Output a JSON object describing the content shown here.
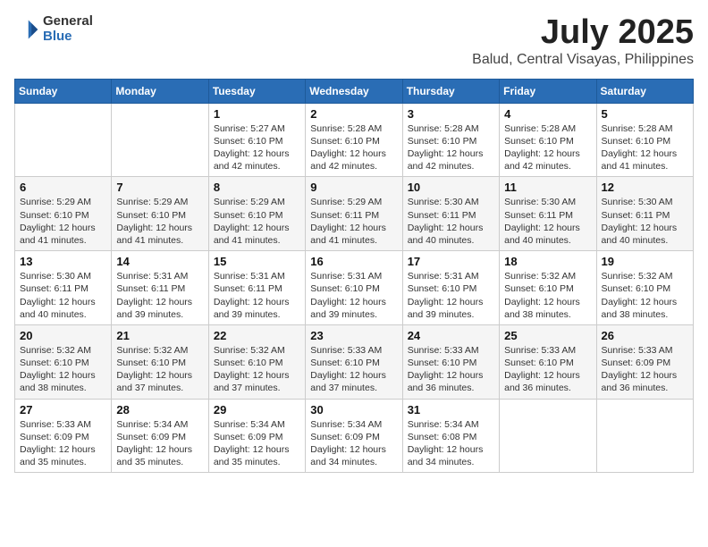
{
  "header": {
    "logo_line1": "General",
    "logo_line2": "Blue",
    "title": "July 2025",
    "subtitle": "Balud, Central Visayas, Philippines"
  },
  "weekdays": [
    "Sunday",
    "Monday",
    "Tuesday",
    "Wednesday",
    "Thursday",
    "Friday",
    "Saturday"
  ],
  "weeks": [
    [
      {
        "day": "",
        "info": ""
      },
      {
        "day": "",
        "info": ""
      },
      {
        "day": "1",
        "info": "Sunrise: 5:27 AM\nSunset: 6:10 PM\nDaylight: 12 hours and 42 minutes."
      },
      {
        "day": "2",
        "info": "Sunrise: 5:28 AM\nSunset: 6:10 PM\nDaylight: 12 hours and 42 minutes."
      },
      {
        "day": "3",
        "info": "Sunrise: 5:28 AM\nSunset: 6:10 PM\nDaylight: 12 hours and 42 minutes."
      },
      {
        "day": "4",
        "info": "Sunrise: 5:28 AM\nSunset: 6:10 PM\nDaylight: 12 hours and 42 minutes."
      },
      {
        "day": "5",
        "info": "Sunrise: 5:28 AM\nSunset: 6:10 PM\nDaylight: 12 hours and 41 minutes."
      }
    ],
    [
      {
        "day": "6",
        "info": "Sunrise: 5:29 AM\nSunset: 6:10 PM\nDaylight: 12 hours and 41 minutes."
      },
      {
        "day": "7",
        "info": "Sunrise: 5:29 AM\nSunset: 6:10 PM\nDaylight: 12 hours and 41 minutes."
      },
      {
        "day": "8",
        "info": "Sunrise: 5:29 AM\nSunset: 6:10 PM\nDaylight: 12 hours and 41 minutes."
      },
      {
        "day": "9",
        "info": "Sunrise: 5:29 AM\nSunset: 6:11 PM\nDaylight: 12 hours and 41 minutes."
      },
      {
        "day": "10",
        "info": "Sunrise: 5:30 AM\nSunset: 6:11 PM\nDaylight: 12 hours and 40 minutes."
      },
      {
        "day": "11",
        "info": "Sunrise: 5:30 AM\nSunset: 6:11 PM\nDaylight: 12 hours and 40 minutes."
      },
      {
        "day": "12",
        "info": "Sunrise: 5:30 AM\nSunset: 6:11 PM\nDaylight: 12 hours and 40 minutes."
      }
    ],
    [
      {
        "day": "13",
        "info": "Sunrise: 5:30 AM\nSunset: 6:11 PM\nDaylight: 12 hours and 40 minutes."
      },
      {
        "day": "14",
        "info": "Sunrise: 5:31 AM\nSunset: 6:11 PM\nDaylight: 12 hours and 39 minutes."
      },
      {
        "day": "15",
        "info": "Sunrise: 5:31 AM\nSunset: 6:11 PM\nDaylight: 12 hours and 39 minutes."
      },
      {
        "day": "16",
        "info": "Sunrise: 5:31 AM\nSunset: 6:10 PM\nDaylight: 12 hours and 39 minutes."
      },
      {
        "day": "17",
        "info": "Sunrise: 5:31 AM\nSunset: 6:10 PM\nDaylight: 12 hours and 39 minutes."
      },
      {
        "day": "18",
        "info": "Sunrise: 5:32 AM\nSunset: 6:10 PM\nDaylight: 12 hours and 38 minutes."
      },
      {
        "day": "19",
        "info": "Sunrise: 5:32 AM\nSunset: 6:10 PM\nDaylight: 12 hours and 38 minutes."
      }
    ],
    [
      {
        "day": "20",
        "info": "Sunrise: 5:32 AM\nSunset: 6:10 PM\nDaylight: 12 hours and 38 minutes."
      },
      {
        "day": "21",
        "info": "Sunrise: 5:32 AM\nSunset: 6:10 PM\nDaylight: 12 hours and 37 minutes."
      },
      {
        "day": "22",
        "info": "Sunrise: 5:32 AM\nSunset: 6:10 PM\nDaylight: 12 hours and 37 minutes."
      },
      {
        "day": "23",
        "info": "Sunrise: 5:33 AM\nSunset: 6:10 PM\nDaylight: 12 hours and 37 minutes."
      },
      {
        "day": "24",
        "info": "Sunrise: 5:33 AM\nSunset: 6:10 PM\nDaylight: 12 hours and 36 minutes."
      },
      {
        "day": "25",
        "info": "Sunrise: 5:33 AM\nSunset: 6:10 PM\nDaylight: 12 hours and 36 minutes."
      },
      {
        "day": "26",
        "info": "Sunrise: 5:33 AM\nSunset: 6:09 PM\nDaylight: 12 hours and 36 minutes."
      }
    ],
    [
      {
        "day": "27",
        "info": "Sunrise: 5:33 AM\nSunset: 6:09 PM\nDaylight: 12 hours and 35 minutes."
      },
      {
        "day": "28",
        "info": "Sunrise: 5:34 AM\nSunset: 6:09 PM\nDaylight: 12 hours and 35 minutes."
      },
      {
        "day": "29",
        "info": "Sunrise: 5:34 AM\nSunset: 6:09 PM\nDaylight: 12 hours and 35 minutes."
      },
      {
        "day": "30",
        "info": "Sunrise: 5:34 AM\nSunset: 6:09 PM\nDaylight: 12 hours and 34 minutes."
      },
      {
        "day": "31",
        "info": "Sunrise: 5:34 AM\nSunset: 6:08 PM\nDaylight: 12 hours and 34 minutes."
      },
      {
        "day": "",
        "info": ""
      },
      {
        "day": "",
        "info": ""
      }
    ]
  ]
}
